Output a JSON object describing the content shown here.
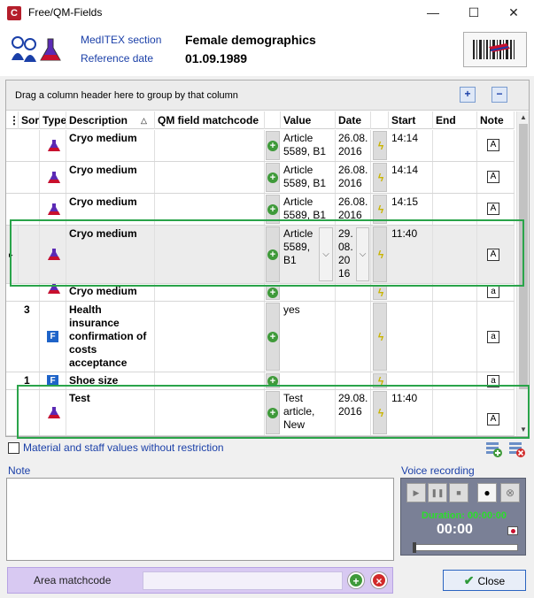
{
  "window": {
    "title": "Free/QM-Fields",
    "minimize": "—",
    "maximize": "☐",
    "close": "✕"
  },
  "header": {
    "section_label": "MedITEX section",
    "section_value": "Female demographics",
    "date_label": "Reference date",
    "date_value": "01.09.1989"
  },
  "grid": {
    "group_hint": "Drag a column header here to group by that column",
    "expand_all": "+",
    "collapse_all": "−",
    "columns": {
      "sort": "Sor",
      "type": "Type",
      "description": "Description",
      "sort_indicator": "△",
      "matchcode": "QM field matchcode",
      "value": "Value",
      "date": "Date",
      "start": "Start",
      "end": "End",
      "note": "Note"
    },
    "rows": [
      {
        "sort": "",
        "type": "flask",
        "description": "Cryo medium",
        "value": "Article 5589, B1",
        "date": "26.08. 2016",
        "start": "14:14",
        "end": ""
      },
      {
        "sort": "",
        "type": "flask",
        "description": "Cryo medium",
        "value": "Article 5589, B1",
        "date": "26.08. 2016",
        "start": "14:14",
        "end": ""
      },
      {
        "sort": "",
        "type": "flask",
        "description": "Cryo medium",
        "value": "Article 5589, B1",
        "date": "26.08. 2016",
        "start": "14:15",
        "end": ""
      },
      {
        "sort": "",
        "type": "flask",
        "description": "Cryo medium",
        "value": "Article 5589, B1",
        "date": "29. 08. 20 16",
        "start": "11:40",
        "end": ""
      },
      {
        "sort": "",
        "type": "flask",
        "description": "Cryo medium",
        "value": "",
        "date": "",
        "start": "",
        "end": ""
      },
      {
        "sort": "3",
        "type": "F",
        "description": "Health insurance confirmation of costs acceptance",
        "value": "yes",
        "date": "",
        "start": "",
        "end": ""
      },
      {
        "sort": "1",
        "type": "F",
        "description": "Shoe size",
        "value": "",
        "date": "",
        "start": "",
        "end": ""
      },
      {
        "sort": "",
        "type": "flask",
        "description": "Test",
        "value": "Test article, New",
        "date": "29.08. 2016",
        "start": "11:40",
        "end": ""
      }
    ]
  },
  "options": {
    "unrestricted_label": "Material and staff values without restriction"
  },
  "note": {
    "label": "Note",
    "value": ""
  },
  "voice": {
    "label": "Voice recording",
    "duration": "Duration: 00:00:00",
    "time": "00:00"
  },
  "area": {
    "label": "Area matchcode",
    "value": ""
  },
  "footer": {
    "close_label": "Close"
  },
  "colors": {
    "highlight": "#2aa44a",
    "label_blue": "#1a3fa8",
    "area_bg": "#d8c9f2"
  }
}
